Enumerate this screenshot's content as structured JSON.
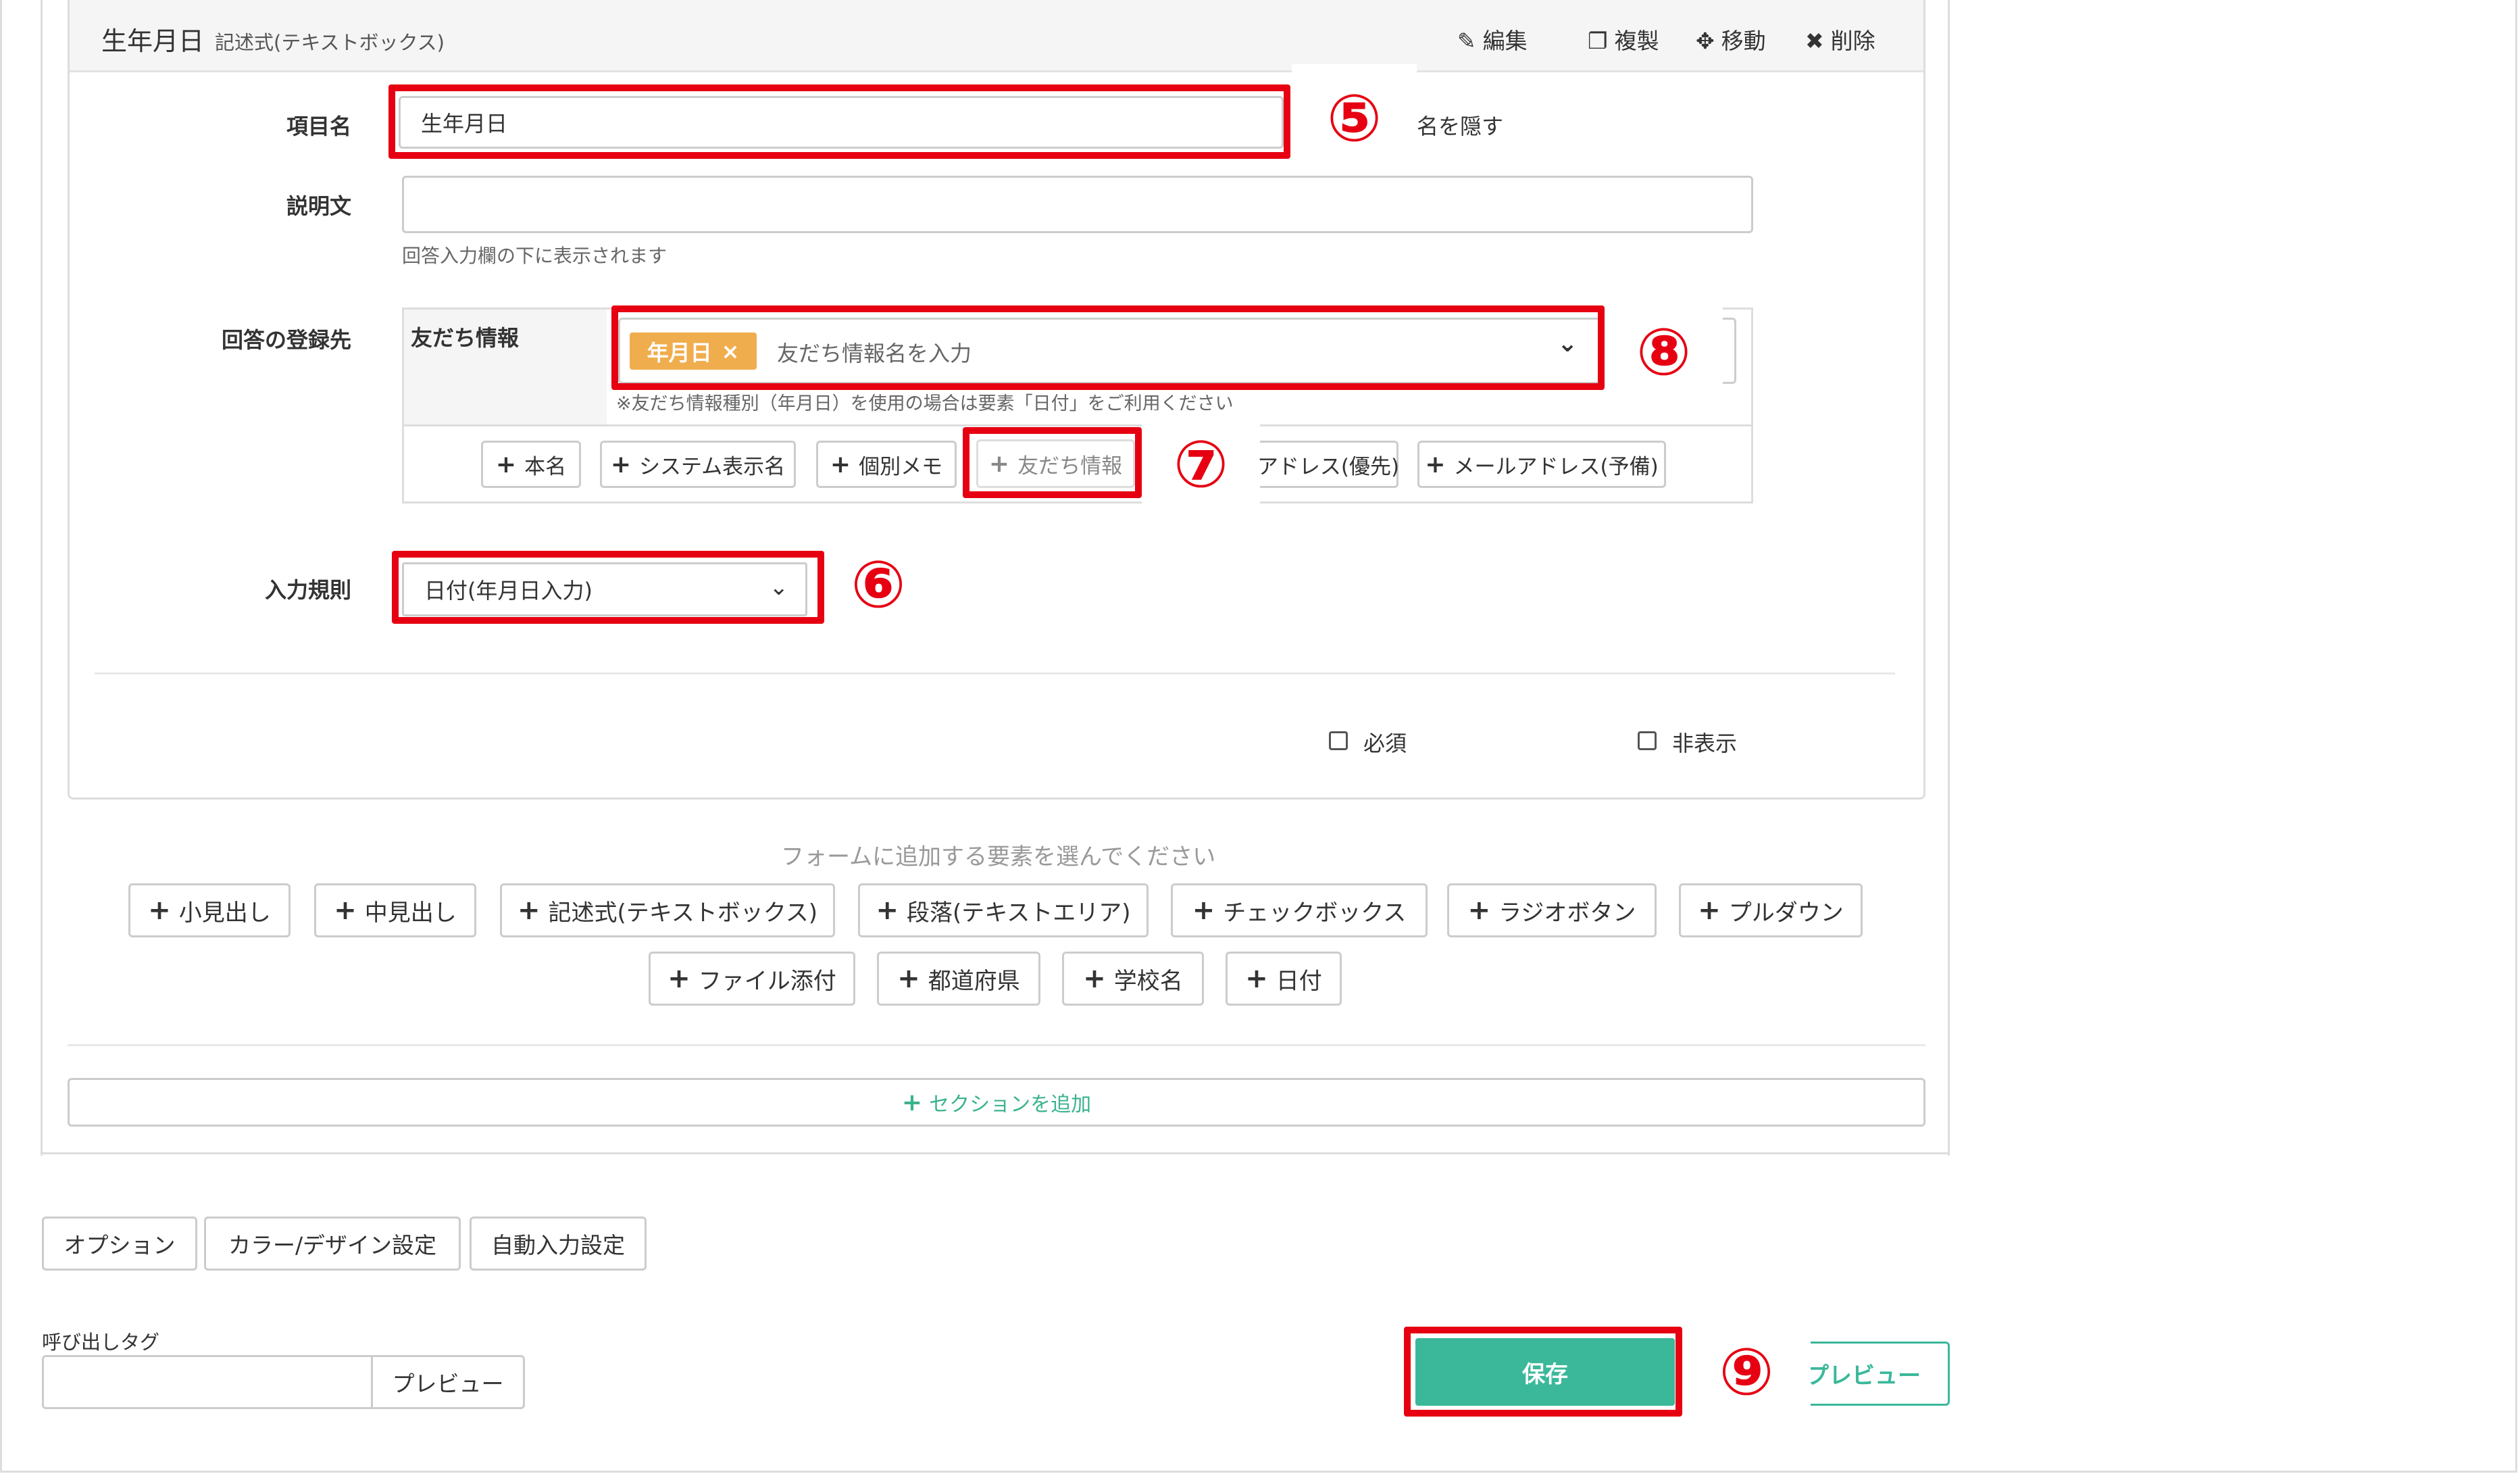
{
  "field": {
    "title": "生年月日",
    "type_label": "記述式(テキストボックス)",
    "actions": [
      {
        "icon": "pencil-icon",
        "glyph": "✎",
        "label": "編集"
      },
      {
        "icon": "copy-icon",
        "glyph": "❐",
        "label": "複製"
      },
      {
        "icon": "move-icon",
        "glyph": "✥",
        "label": "移動"
      },
      {
        "icon": "delete-icon",
        "glyph": "✖",
        "label": "削除"
      }
    ]
  },
  "form": {
    "item_name_label": "項目名",
    "item_name_value": "生年月日",
    "hide_name_text": "名を隠す",
    "description_label": "説明文",
    "description_value": "",
    "description_hint": "回答入力欄の下に表示されます",
    "registration_label": "回答の登録先",
    "friend_info_label": "友だち情報",
    "friend_tag": "年月日",
    "friend_placeholder": "友だち情報名を入力",
    "friend_note": "※友だち情報種別（年月日）を使用の場合は要素「日付」をご利用ください",
    "destination_buttons": [
      "本名",
      "システム表示名",
      "個別メモ",
      "友だち情報",
      "アドレス(優先)",
      "メールアドレス(予備)"
    ],
    "input_rule_label": "入力規則",
    "input_rule_value": "日付(年月日入力)",
    "required_label": "必須",
    "hidden_label": "非表示"
  },
  "add_elements": {
    "prompt": "フォームに追加する要素を選んでください",
    "row1": [
      "小見出し",
      "中見出し",
      "記述式(テキストボックス)",
      "段落(テキストエリア)",
      "チェックボックス",
      "ラジオボタン",
      "プルダウン"
    ],
    "row2": [
      "ファイル添付",
      "都道府県",
      "学校名",
      "日付"
    ],
    "add_section": "セクションを追加"
  },
  "settings_tabs": [
    "オプション",
    "カラー/デザイン設定",
    "自動入力設定"
  ],
  "call_tag": {
    "label": "呼び出しタグ",
    "value": "",
    "preview_button": "プレビュー"
  },
  "footer": {
    "save": "保存",
    "preview": "プレビュー"
  },
  "annotations": [
    "⑤",
    "⑥",
    "⑦",
    "⑧",
    "⑨"
  ],
  "colors": {
    "accent": "#3bb89a",
    "highlight": "#e60012",
    "tag": "#f0ad4e"
  }
}
